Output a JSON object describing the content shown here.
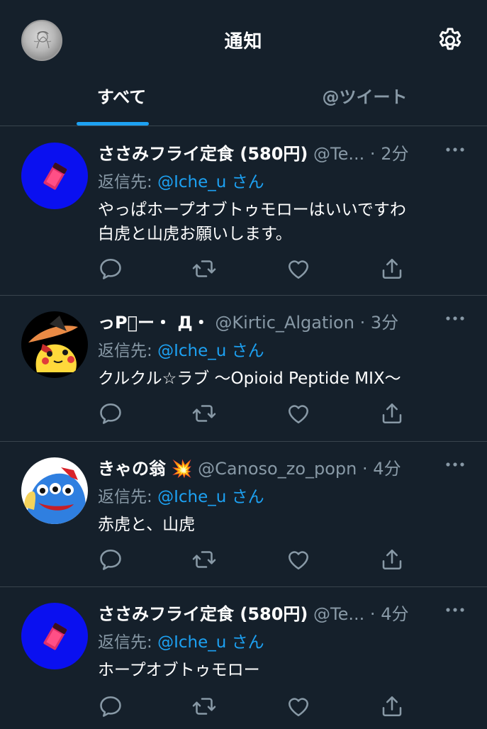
{
  "header": {
    "title": "通知"
  },
  "tabs": [
    {
      "label": "すべて",
      "active": true
    },
    {
      "label": "@ツイート",
      "active": false
    }
  ],
  "colors": {
    "background": "#15202b",
    "accent": "#1da1f2",
    "secondary_text": "#8899a6",
    "divider": "#38444d"
  },
  "tweets": [
    {
      "display_name": "ささみフライ定食 (580円)",
      "handle": "@Te...",
      "dot": "·",
      "time": "2分",
      "reply_prefix": "返信先: ",
      "reply_to": "@Iche_u",
      "reply_suffix": " さん",
      "text": "やっぱホープオブトゥモローはいいですわ\n白虎と山虎お願いします。",
      "avatar_icon": "pink-card-on-blue-avatar"
    },
    {
      "display_name": "っP゚ー・ Д・",
      "handle": "@Kirtic_Algation",
      "dot": "·",
      "time": "3分",
      "reply_prefix": "返信先: ",
      "reply_to": "@Iche_u",
      "reply_suffix": " さん",
      "text": "クルクル☆ラブ 〜Opioid Peptide MIX〜",
      "avatar_icon": "pikachu-witch-hat-avatar"
    },
    {
      "display_name": "きゃの翁",
      "name_emoji": "💥",
      "handle": "@Canoso_zo_popn",
      "dot": "·",
      "time": "4分",
      "reply_prefix": "返信先: ",
      "reply_to": "@Iche_u",
      "reply_suffix": " さん",
      "text": "赤虎と、山虎",
      "avatar_icon": "blue-three-eyed-character-avatar"
    },
    {
      "display_name": "ささみフライ定食 (580円)",
      "handle": "@Te...",
      "dot": "·",
      "time": "4分",
      "reply_prefix": "返信先: ",
      "reply_to": "@Iche_u",
      "reply_suffix": " さん",
      "text": "ホープオブトゥモロー",
      "avatar_icon": "pink-card-on-blue-avatar"
    }
  ],
  "action_icons": [
    "reply-icon",
    "retweet-icon",
    "like-icon",
    "share-icon"
  ]
}
